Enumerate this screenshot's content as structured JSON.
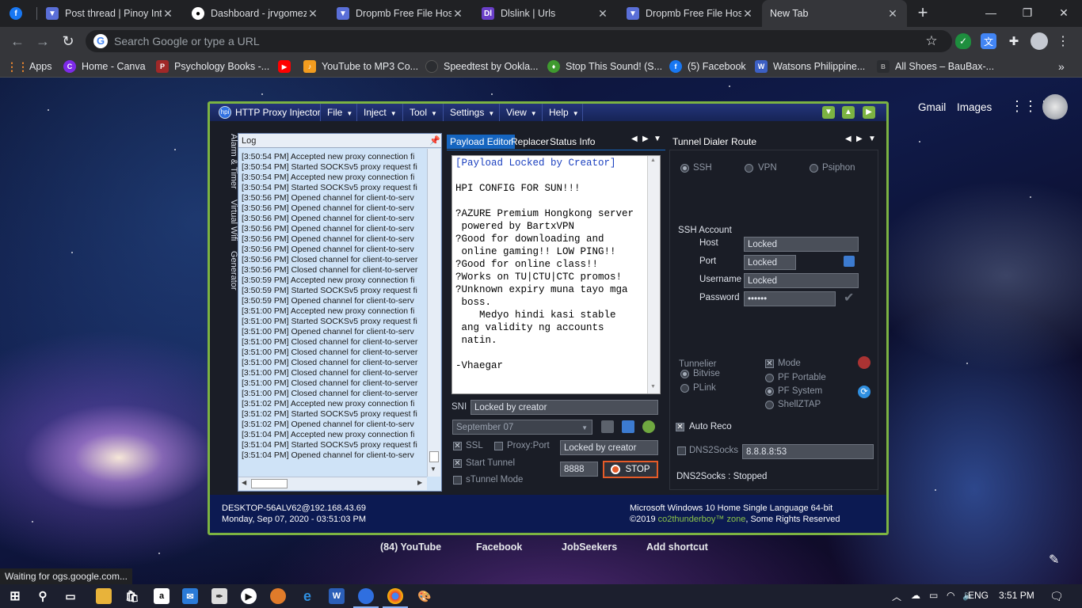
{
  "browser": {
    "tabs": [
      {
        "title": "Post thread | Pinoy Int",
        "icon": "pinoy-icon"
      },
      {
        "title": "Dashboard - jrvgomez",
        "icon": "github-icon"
      },
      {
        "title": "Dropmb Free File Host",
        "icon": "dropmb-icon"
      },
      {
        "title": "Dlslink | Urls",
        "icon": "dlslink-icon",
        "badge": "Dl"
      },
      {
        "title": "Dropmb Free File Host",
        "icon": "dropmb-icon"
      },
      {
        "title": "New Tab",
        "icon": "",
        "active": true
      }
    ],
    "omnibox_placeholder": "Search Google or type a URL",
    "bookmarks": [
      {
        "label": "Apps",
        "icon": "apps-grid-icon"
      },
      {
        "label": "Home - Canva",
        "icon": "canva-icon",
        "badge": "C"
      },
      {
        "label": "Psychology Books -...",
        "icon": "pdfdrive-icon",
        "badge": "P"
      },
      {
        "label": "",
        "icon": "youtube-icon"
      },
      {
        "label": "YouTube to MP3 Co...",
        "icon": "converter-icon"
      },
      {
        "label": "Speedtest by Ookla...",
        "icon": "speedtest-icon"
      },
      {
        "label": "Stop This Sound! (S...",
        "icon": "stop-sound-icon"
      },
      {
        "label": "(5) Facebook",
        "icon": "facebook-icon",
        "badge": "f"
      },
      {
        "label": "Watsons Philippine...",
        "icon": "watsons-icon",
        "badge": "W"
      },
      {
        "label": "All Shoes – BauBax-...",
        "icon": "baubax-icon"
      }
    ],
    "newtab": {
      "gmail": "Gmail",
      "images": "Images",
      "shortcuts": [
        "(84) YouTube",
        "Facebook",
        "JobSeekers",
        "Add shortcut"
      ]
    },
    "status_text": "Waiting for ogs.google.com..."
  },
  "hpi": {
    "title": "HTTP Proxy Injector",
    "menus": [
      "File",
      "Inject",
      "Tool",
      "Settings",
      "View",
      "Help"
    ],
    "side_tabs": [
      "Alarm & Timer",
      "Virtual Wifi",
      "Generator"
    ],
    "log": {
      "header": "Log",
      "lines": [
        "[3:50:54 PM] Accepted new proxy connection fi",
        "[3:50:54 PM] Started SOCKSv5 proxy request fi",
        "[3:50:54 PM] Accepted new proxy connection fi",
        "[3:50:54 PM] Started SOCKSv5 proxy request fi",
        "[3:50:56 PM] Opened channel for client-to-serv",
        "[3:50:56 PM] Opened channel for client-to-serv",
        "[3:50:56 PM] Opened channel for client-to-serv",
        "[3:50:56 PM] Opened channel for client-to-serv",
        "[3:50:56 PM] Opened channel for client-to-serv",
        "[3:50:56 PM] Opened channel for client-to-serv",
        "[3:50:56 PM] Closed channel for client-to-server",
        "[3:50:56 PM] Closed channel for client-to-server",
        "[3:50:59 PM] Accepted new proxy connection fi",
        "[3:50:59 PM] Started SOCKSv5 proxy request fi",
        "[3:50:59 PM] Opened channel for client-to-serv",
        "[3:51:00 PM] Accepted new proxy connection fi",
        "[3:51:00 PM] Started SOCKSv5 proxy request fi",
        "[3:51:00 PM] Opened channel for client-to-serv",
        "[3:51:00 PM] Closed channel for client-to-server",
        "[3:51:00 PM] Closed channel for client-to-server",
        "[3:51:00 PM] Closed channel for client-to-server",
        "[3:51:00 PM] Closed channel for client-to-server",
        "[3:51:00 PM] Closed channel for client-to-server",
        "[3:51:00 PM] Closed channel for client-to-server",
        "[3:51:02 PM] Accepted new proxy connection fi",
        "[3:51:02 PM] Started SOCKSv5 proxy request fi",
        "[3:51:02 PM] Opened channel for client-to-serv",
        "[3:51:04 PM] Accepted new proxy connection fi",
        "[3:51:04 PM] Started SOCKSv5 proxy request fi",
        "[3:51:04 PM] Opened channel for client-to-serv"
      ]
    },
    "center_tabs": [
      "Payload Editor",
      "Replacer",
      "Status Info"
    ],
    "payload_lines": [
      {
        "text": "[Payload Locked by Creator]",
        "color": "#1a3fbf"
      },
      {
        "text": ""
      },
      {
        "text": "HPI CONFIG FOR SUN!!!"
      },
      {
        "text": ""
      },
      {
        "text": "?AZURE Premium Hongkong server"
      },
      {
        "text": " powered by BartxVPN"
      },
      {
        "text": "?Good for downloading and"
      },
      {
        "text": " online gaming!! LOW PING!!"
      },
      {
        "text": "?Good for online class!!"
      },
      {
        "text": "?Works on TU|CTU|CTC promos!"
      },
      {
        "text": "?Unknown expiry muna tayo mga"
      },
      {
        "text": " boss."
      },
      {
        "text": "    Medyo hindi kasi stable"
      },
      {
        "text": " ang validity ng accounts"
      },
      {
        "text": " natin."
      },
      {
        "text": ""
      },
      {
        "text": "-Vhaegar"
      }
    ],
    "sni_label": "SNI",
    "sni_value": "Locked by creator",
    "config_select": "September 07",
    "ssl_label": "SSL",
    "proxyport_label": "Proxy:Port",
    "proxy_value": "Locked by creator",
    "start_tunnel_label": "Start Tunnel",
    "stunnel_label": "sTunnel Mode",
    "port_value": "8888",
    "stop_label": "STOP",
    "right_tabs": [
      "Tunnel",
      "Dialer",
      "Route"
    ],
    "tunnel_modes": [
      "SSH",
      "VPN",
      "Psiphon"
    ],
    "ssh": {
      "title": "SSH Account",
      "host_label": "Host",
      "host_value": "Locked",
      "port_label": "Port",
      "port_value": "Locked",
      "username_label": "Username",
      "username_value": "Locked",
      "password_label": "Password",
      "password_value": "••••••"
    },
    "tunnelier_label": "Tunnelier",
    "tunnelier_options": [
      "Bitvise",
      "PLink"
    ],
    "mode_label": "Mode",
    "mode_options": [
      "PF Portable",
      "PF System",
      "ShellZTAP"
    ],
    "auto_reco": "Auto Reco",
    "dns2socks_label": "DNS2Socks",
    "dns_value": "8.8.8.8:53",
    "dns_status": "DNS2Socks : Stopped",
    "status": {
      "host": "DESKTOP-56ALV62@192.168.43.69",
      "datetime": "Monday, Sep 07, 2020 - 03:51:03 PM",
      "os": "Microsoft Windows 10 Home Single Language 64-bit",
      "copyright_prefix": "©2019",
      "copyright_author": "co2thunderboy™ zone",
      "copyright_suffix": ", Some Rights Reserved"
    }
  },
  "taskbar": {
    "language": "ENG",
    "time": "3:51 PM"
  }
}
